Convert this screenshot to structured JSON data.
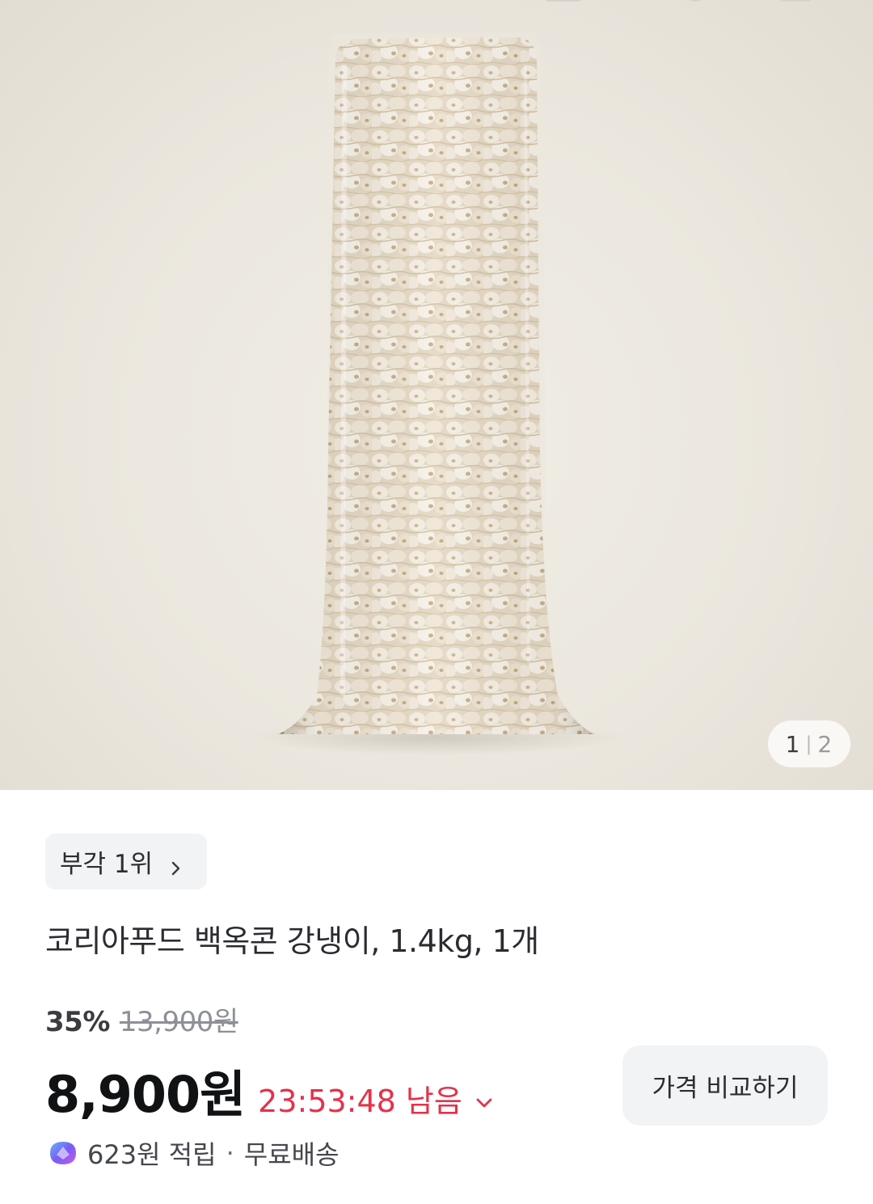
{
  "gallery": {
    "current_index": "1",
    "separator": "|",
    "total": "2",
    "image_subject": "bag of puffed corn snack (popcorn)"
  },
  "product": {
    "rank_badge": "부각 1위",
    "title": "코리아푸드 백옥콘 강냉이, 1.4kg, 1개",
    "discount_rate": "35%",
    "original_price": "13,900원",
    "sale_price": "8,900원",
    "timer": "23:53:48 남음",
    "compare_button": "가격 비교하기",
    "reward": "623원 적립",
    "benefit_separator": "·",
    "shipping": "무료배송"
  },
  "colors": {
    "timer_red": "#e3324a",
    "chip_bg": "#f2f3f5",
    "price_black": "#111214",
    "reward_purple": "#7b5cf0"
  },
  "icons": {
    "rank_chevron": "chevron-right-icon",
    "timer_chevron": "chevron-down-icon",
    "reward": "reward-coin-icon"
  }
}
